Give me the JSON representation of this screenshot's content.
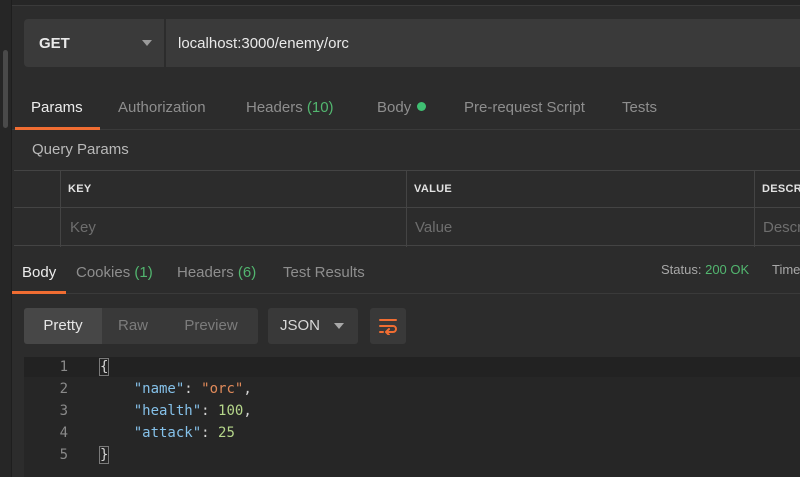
{
  "request": {
    "method": "GET",
    "url": "localhost:3000/enemy/orc"
  },
  "request_tabs": [
    {
      "label": "Params"
    },
    {
      "label": "Authorization"
    },
    {
      "label": "Headers",
      "count": "(10)"
    },
    {
      "label": "Body"
    },
    {
      "label": "Pre-request Script"
    },
    {
      "label": "Tests"
    }
  ],
  "query_params": {
    "title": "Query Params",
    "headers": [
      "KEY",
      "VALUE",
      "DESCRI"
    ],
    "placeholders": [
      "Key",
      "Value",
      "Descri"
    ]
  },
  "response_tabs": [
    {
      "label": "Body"
    },
    {
      "label": "Cookies",
      "count": "(1)"
    },
    {
      "label": "Headers",
      "count": "(6)"
    },
    {
      "label": "Test Results"
    }
  ],
  "status": {
    "label": "Status:",
    "value": "200 OK",
    "time_label": "Time"
  },
  "view_modes": [
    "Pretty",
    "Raw",
    "Preview"
  ],
  "format": "JSON",
  "code": {
    "line_numbers": [
      "1",
      "2",
      "3",
      "4",
      "5"
    ],
    "open_brace": "{",
    "close_brace": "}",
    "name_key": "\"name\"",
    "name_value": "\"orc\"",
    "health_key": "\"health\"",
    "health_value": "100",
    "attack_key": "\"attack\"",
    "attack_value": "25"
  },
  "colors": {
    "accent": "#f06d32",
    "success": "#52b66f"
  }
}
